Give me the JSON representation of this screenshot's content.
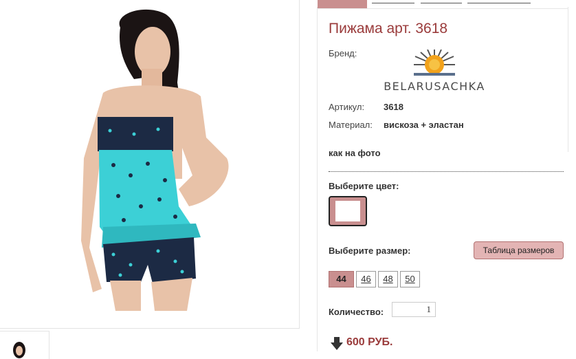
{
  "product": {
    "title": "Пижама арт. 3618",
    "brand_label": "Бренд:",
    "brand_name": "BELARUSACHKA",
    "article_label": "Артикул:",
    "article_value": "3618",
    "material_label": "Материал:",
    "material_value": "вискоза + эластан",
    "note": "как на фото"
  },
  "color": {
    "label": "Выберите цвет:",
    "selected_swatch": "#c98f8f"
  },
  "size": {
    "label": "Выберите размер:",
    "table_button": "Таблица размеров",
    "options": [
      "44",
      "46",
      "48",
      "50"
    ],
    "selected": "44"
  },
  "quantity": {
    "label": "Количество:",
    "value": "1"
  },
  "price": {
    "text": "600 РУБ.",
    "arrow_icon": "down-arrow-icon"
  },
  "colors": {
    "accent": "#9a3b3b",
    "highlight": "#c98f8f",
    "button": "#e3b4b4"
  }
}
